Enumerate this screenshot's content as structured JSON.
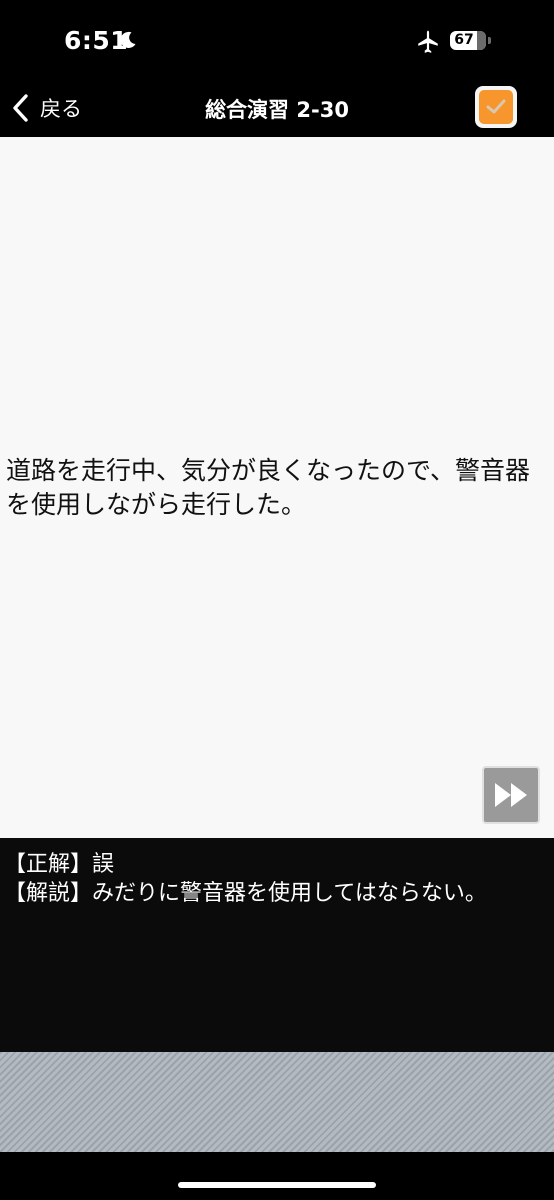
{
  "status_bar": {
    "time": "6:51",
    "battery_level": "67",
    "icons": [
      "moon-icon",
      "airplane-icon",
      "battery-icon"
    ]
  },
  "nav": {
    "back_label": "戻る",
    "title": "総合演習 2-30",
    "check_checked": true
  },
  "question": {
    "text": "道路を走行中、気分が良くなったので、警音器を使用しながら走行した。"
  },
  "answer": {
    "correct_line": "【正解】誤",
    "explanation_line": "【解説】みだりに警音器を使用してはならない。"
  },
  "colors": {
    "accent_orange": "#f7962d",
    "background_dark": "#000000",
    "question_bg": "#f8f8f8",
    "answer_bg": "#0b0b0b"
  }
}
